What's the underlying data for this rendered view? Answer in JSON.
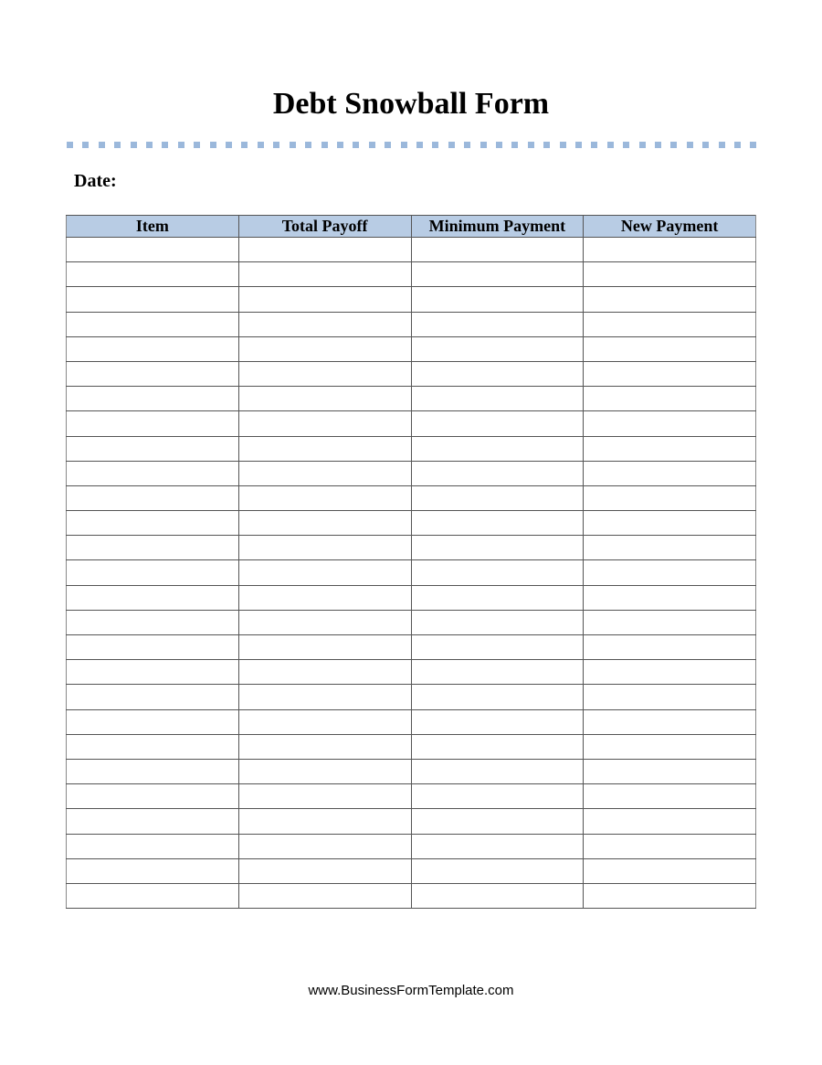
{
  "title": "Debt Snowball Form",
  "date_label": "Date:",
  "table": {
    "columns": [
      "Item",
      "Total Payoff",
      "Minimum Payment",
      "New Payment"
    ],
    "row_count": 27,
    "rows": []
  },
  "footer": "www.BusinessFormTemplate.com",
  "colors": {
    "header_fill": "#b8cce4",
    "divider_dots": "#9bb8db"
  }
}
